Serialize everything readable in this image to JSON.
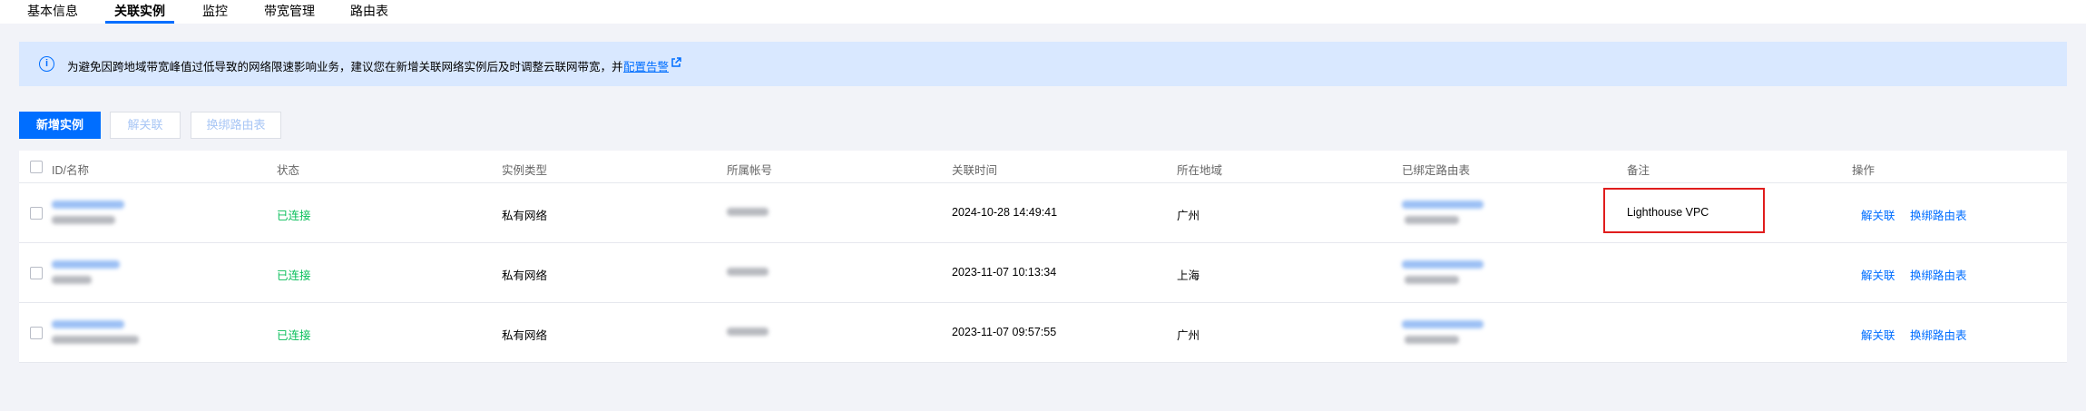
{
  "tabs": [
    {
      "label": "基本信息"
    },
    {
      "label": "关联实例",
      "active": true
    },
    {
      "label": "监控"
    },
    {
      "label": "带宽管理"
    },
    {
      "label": "路由表"
    }
  ],
  "notice": {
    "icon": "info-icon",
    "text": "为避免因跨地域带宽峰值过低导致的网络限速影响业务，建议您在新增关联网络实例后及时调整云联网带宽，并",
    "link_label": "配置告警"
  },
  "toolbar": {
    "add_label": "新增实例",
    "unbind_label": "解关联",
    "rebind_route_label": "换绑路由表"
  },
  "table": {
    "headers": {
      "id": "ID/名称",
      "status": "状态",
      "type": "实例类型",
      "account": "所属帐号",
      "time": "关联时间",
      "region": "所在地域",
      "route": "已绑定路由表",
      "remark": "备注",
      "ops": "操作"
    },
    "rows": [
      {
        "status": "已连接",
        "type": "私有网络",
        "time": "2024-10-28 14:49:41",
        "region": "广州",
        "remark": "Lighthouse VPC",
        "op1": "解关联",
        "op2": "换绑路由表"
      },
      {
        "status": "已连接",
        "type": "私有网络",
        "time": "2023-11-07 10:13:34",
        "region": "上海",
        "remark": "",
        "op1": "解关联",
        "op2": "换绑路由表"
      },
      {
        "status": "已连接",
        "type": "私有网络",
        "time": "2023-11-07 09:57:55",
        "region": "广州",
        "remark": "",
        "op1": "解关联",
        "op2": "换绑路由表"
      }
    ]
  },
  "colors": {
    "accent": "#006eff",
    "status_connected": "#0abf5b",
    "highlight_box": "#e01d1d",
    "notice_bg": "#d9e8ff"
  }
}
